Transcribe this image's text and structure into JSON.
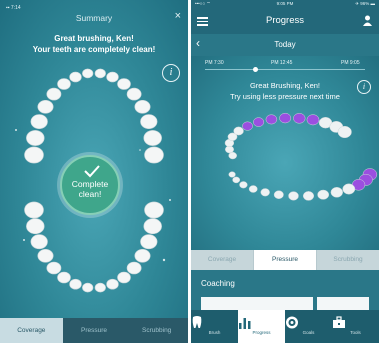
{
  "left": {
    "status": "▪▪ 7:14",
    "title": "Summary",
    "close_icon": "×",
    "message_line1": "Great brushing, Ken!",
    "message_line2": "Your teeth are completely clean!",
    "info_icon": "i",
    "badge_line1": "Complete",
    "badge_line2": "clean!",
    "tabs": [
      {
        "label": "Coverage",
        "active": true
      },
      {
        "label": "Pressure",
        "active": false
      },
      {
        "label": "Scrubbing",
        "active": false
      }
    ]
  },
  "right": {
    "status": {
      "left": "•••○○ ⌔",
      "center": "9:05 PM",
      "right": "✈ 96% ▬"
    },
    "title": "Progress",
    "back_icon": "‹",
    "date": "Today",
    "times": [
      "PM 7:30",
      "PM 12:45",
      "PM 9:05"
    ],
    "message_line1": "Great Brushing, Ken!",
    "message_line2": "Try using less pressure next time",
    "info_icon": "i",
    "tabs": [
      {
        "label": "Coverage",
        "active": false
      },
      {
        "label": "Pressure",
        "active": true
      },
      {
        "label": "Scrubbing",
        "active": false
      }
    ],
    "coaching_title": "Coaching",
    "nav": [
      {
        "label": "Brush",
        "icon": "tooth-icon",
        "active": false
      },
      {
        "label": "Progress",
        "icon": "bar-chart-icon",
        "active": true
      },
      {
        "label": "Goals",
        "icon": "target-icon",
        "active": false
      },
      {
        "label": "Tools",
        "icon": "toolbox-icon",
        "active": false
      }
    ]
  },
  "colors": {
    "teal_dark": "#23687a",
    "teal_mid": "#2f8797",
    "badge_green": "#3fa68b",
    "pressure_purple": "#9b4fe0"
  }
}
